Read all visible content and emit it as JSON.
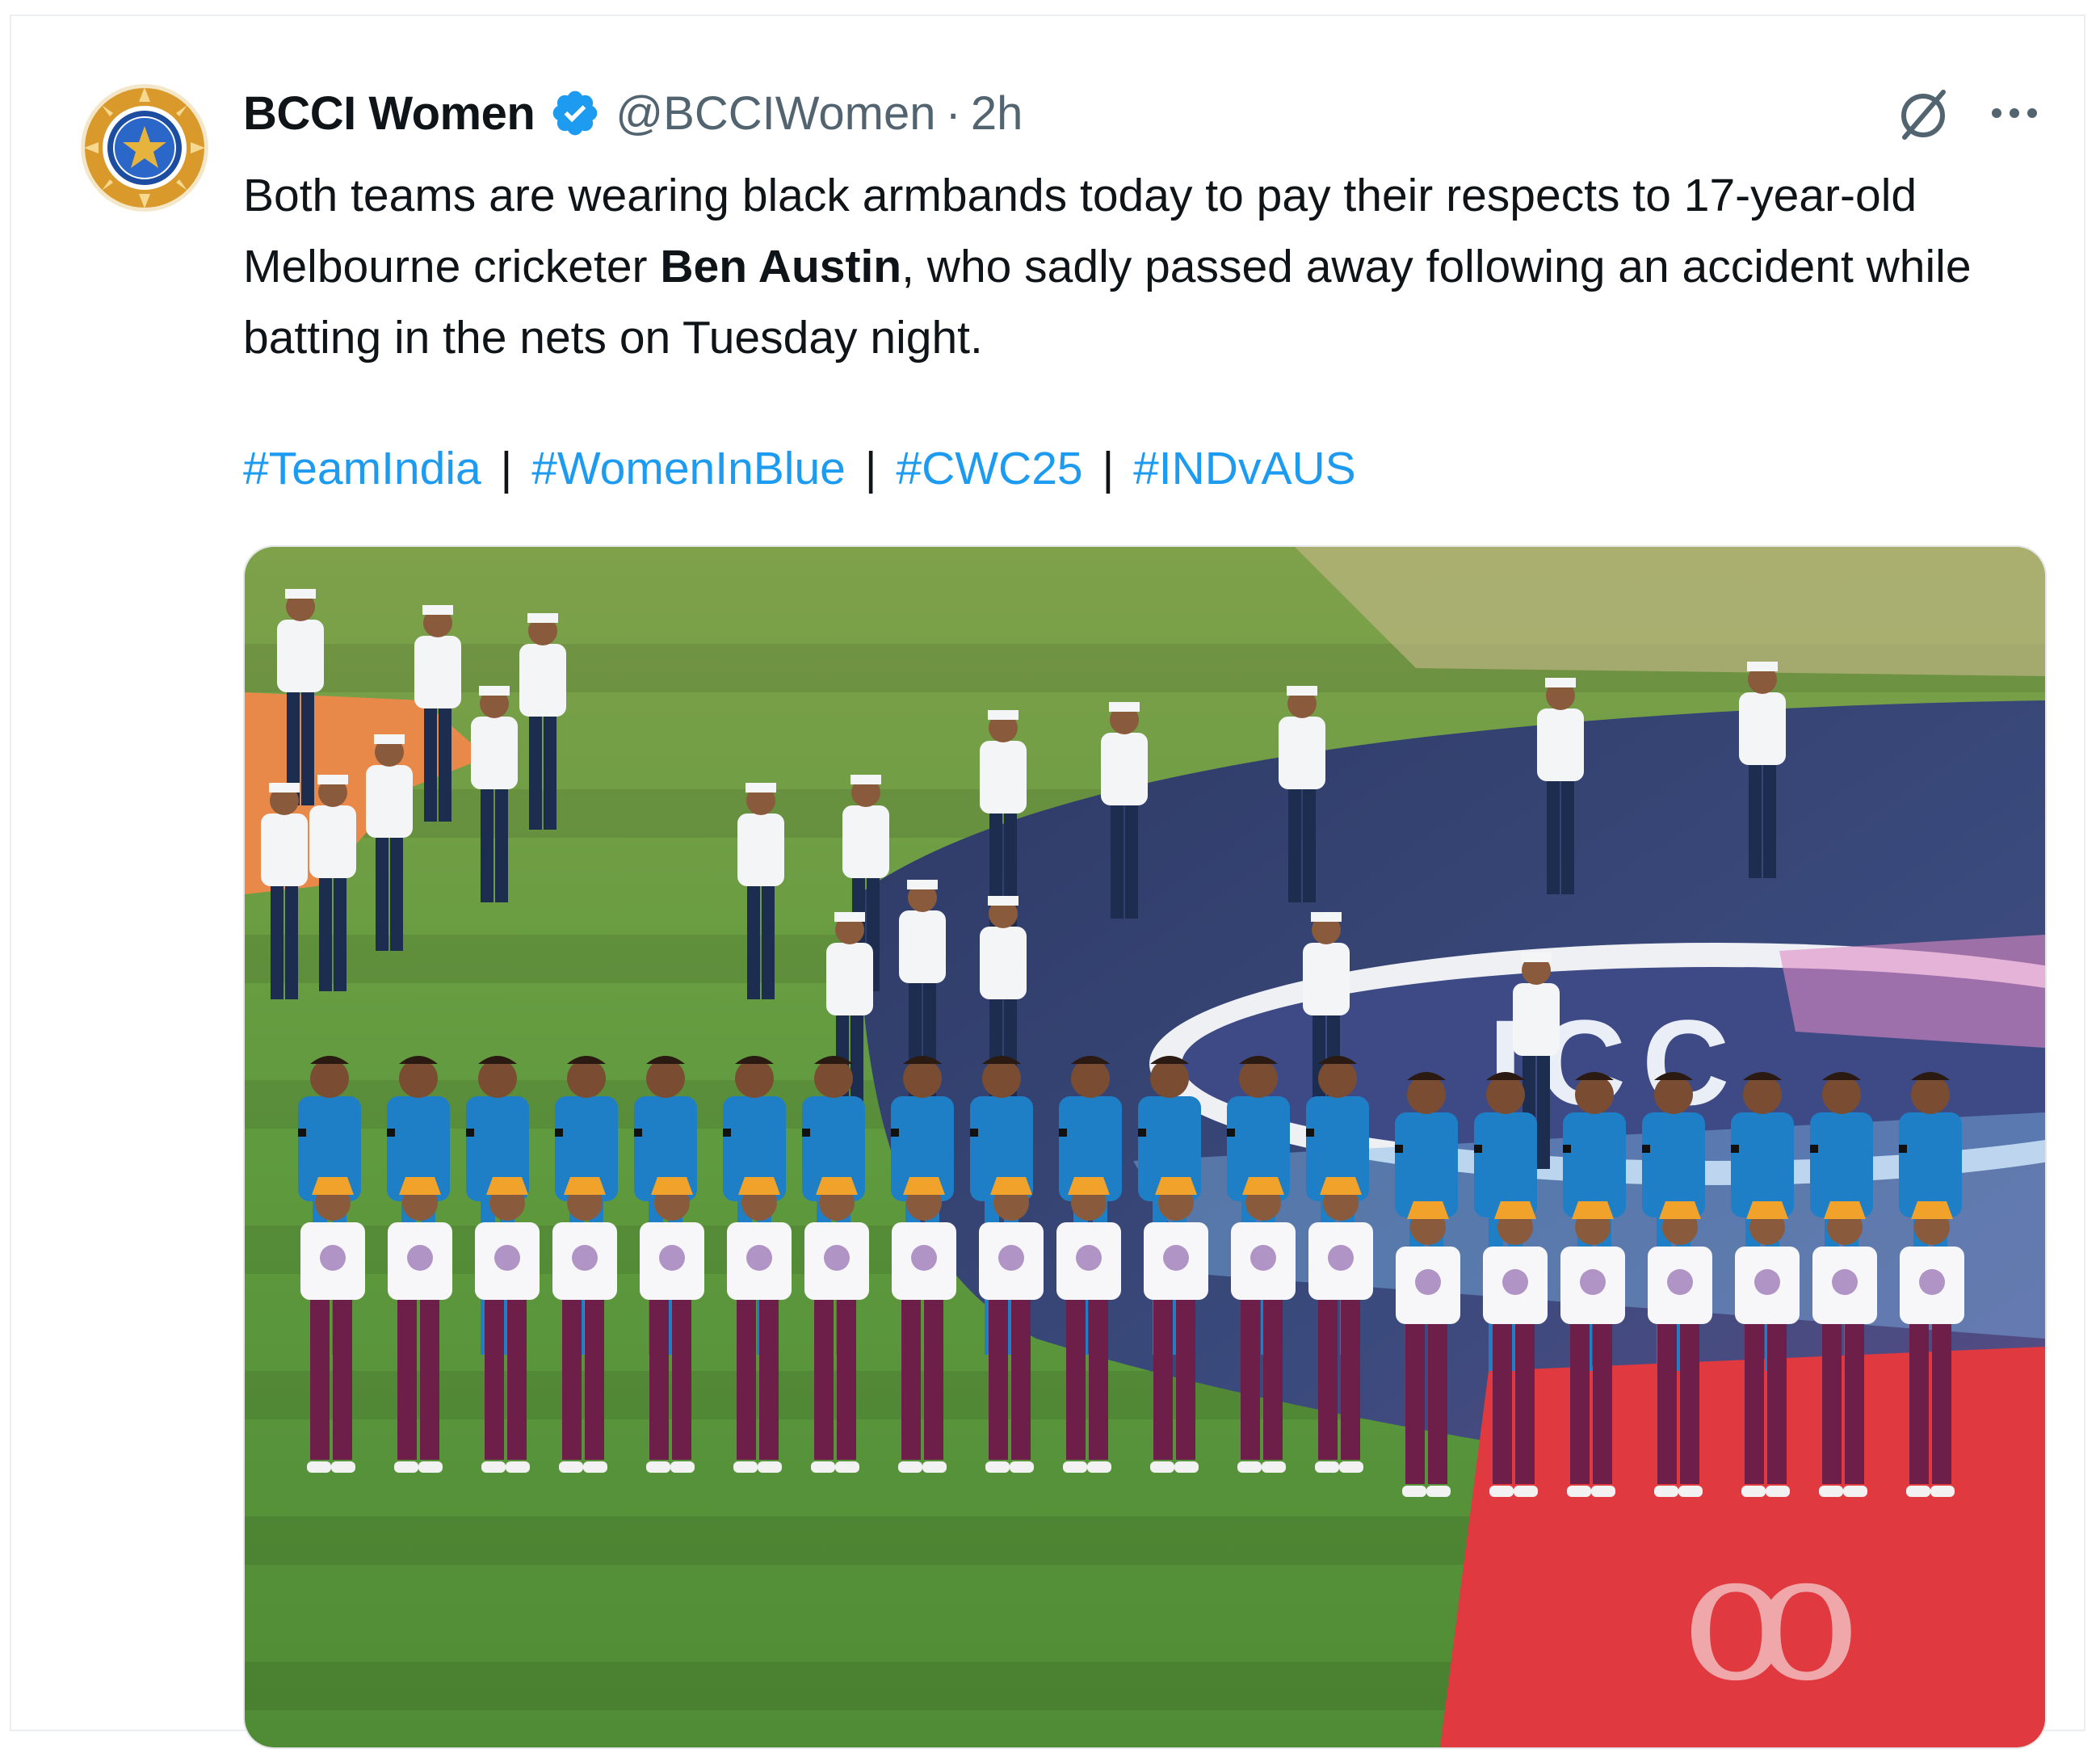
{
  "tweet": {
    "author": {
      "display_name": "BCCI Women",
      "verified_icon": "verified-badge-icon",
      "handle": "@BCCIWomen",
      "separator": "·",
      "time": "2h"
    },
    "text_before": "Both teams are wearing black armbands today to pay their respects to 17-year-old Melbourne cricketer ",
    "text_bold": "Ben Austin",
    "text_after": ", who sadly passed away following an accident while batting in the nets on Tuesday night.",
    "hashtags": [
      "#TeamIndia",
      "#WomenInBlue",
      "#CWC25",
      "#INDvAUS"
    ],
    "hashtag_separator": "|",
    "actions": {
      "grok_icon": "grok-slash-circle-icon",
      "more_icon": "more-dots-icon"
    },
    "media": {
      "banner_text": "ICC",
      "image_icon": "photo-players-line-up-icon"
    }
  },
  "colors": {
    "text": "#0f1419",
    "secondary": "#536471",
    "link": "#1d9bf0",
    "verified": "#1d9bf0",
    "grass": "#5a8f3a",
    "jersey_blue": "#1f7fc6",
    "pants_maroon": "#6d1f4a",
    "carpet_red": "#e0393f"
  }
}
